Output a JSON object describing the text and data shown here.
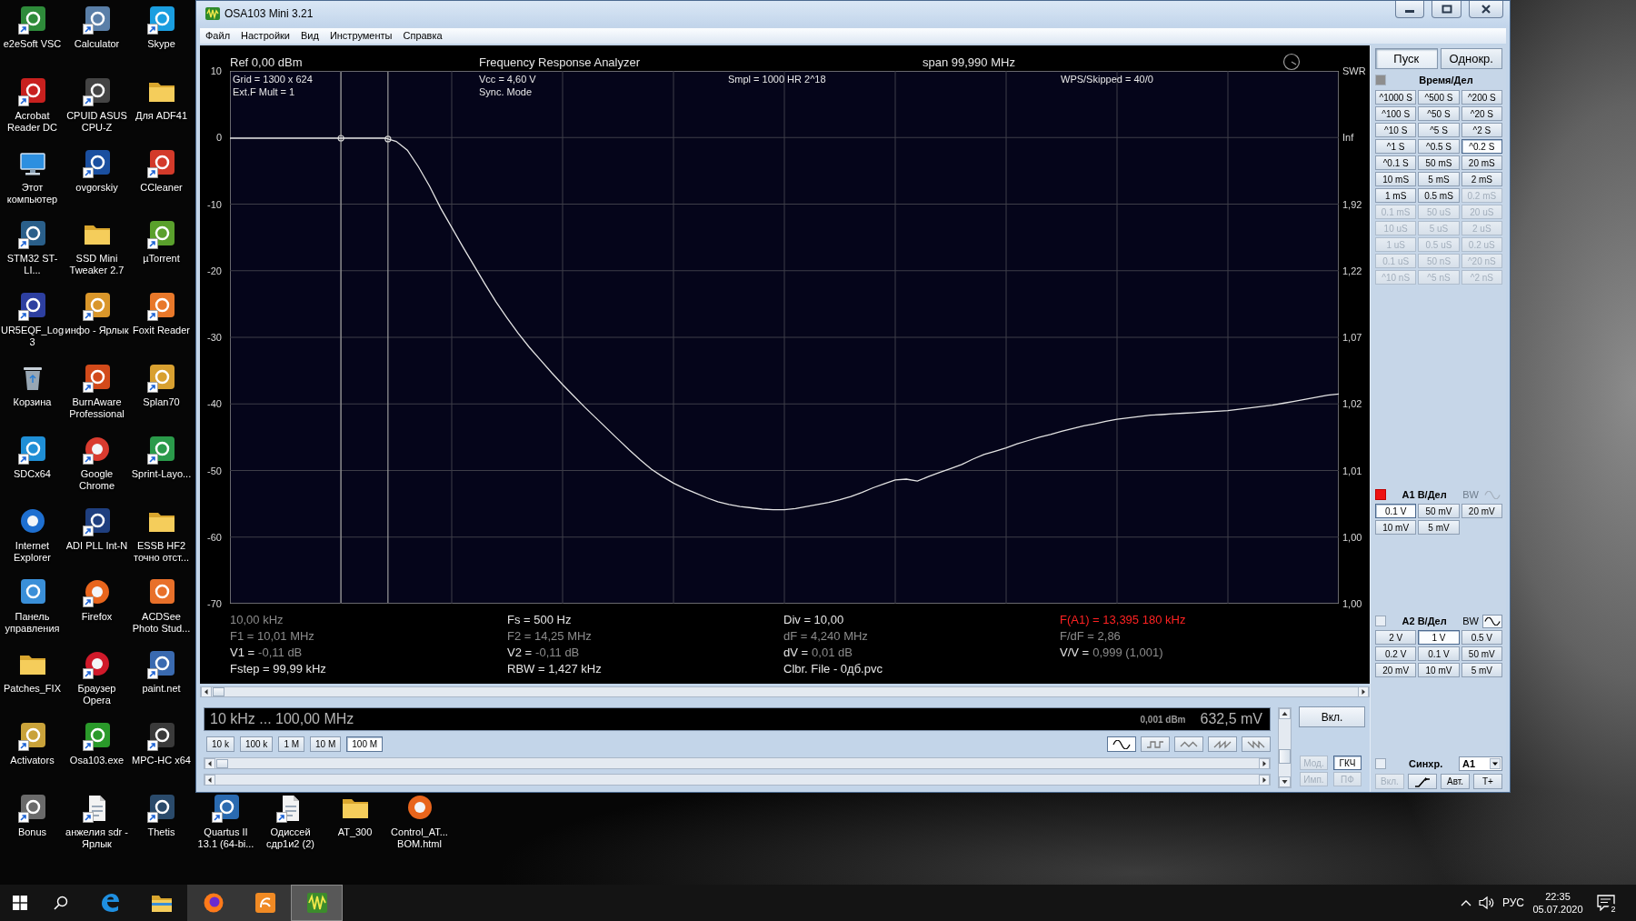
{
  "desktop": {
    "icons": [
      {
        "label": "e2eSoft VSC",
        "kind": "tile",
        "shortcut": true
      },
      {
        "label": "Acrobat Reader DC",
        "kind": "tile",
        "shortcut": true
      },
      {
        "label": "Этот компьютер",
        "kind": "monitor",
        "shortcut": false
      },
      {
        "label": "STM32 ST-LI...",
        "kind": "tile",
        "shortcut": true
      },
      {
        "label": "UR5EQF_Log 3",
        "kind": "tile",
        "shortcut": true
      },
      {
        "label": "Корзина",
        "kind": "trash",
        "shortcut": false
      },
      {
        "label": "SDCx64",
        "kind": "tile",
        "shortcut": true
      },
      {
        "label": "Internet Explorer",
        "kind": "ring",
        "shortcut": false
      },
      {
        "label": "Панель управления",
        "kind": "tile",
        "shortcut": false
      },
      {
        "label": "Patches_FIX",
        "kind": "folder",
        "shortcut": false
      },
      {
        "label": "Activators",
        "kind": "tile",
        "shortcut": true
      },
      {
        "label": "Bonus",
        "kind": "tile",
        "shortcut": true
      },
      {
        "label": "Calculator",
        "kind": "tile",
        "shortcut": true
      },
      {
        "label": "CPUID ASUS CPU-Z",
        "kind": "tile",
        "shortcut": true
      },
      {
        "label": "ovgorskiy",
        "kind": "tile",
        "shortcut": true
      },
      {
        "label": "SSD Mini Tweaker 2.7",
        "kind": "folder",
        "shortcut": false
      },
      {
        "label": "инфо - Ярлык",
        "kind": "tile",
        "shortcut": true
      },
      {
        "label": "BurnAware Professional",
        "kind": "tile",
        "shortcut": true
      },
      {
        "label": "Google Chrome",
        "kind": "ring",
        "shortcut": true
      },
      {
        "label": "ADI PLL Int-N",
        "kind": "tile",
        "shortcut": true
      },
      {
        "label": "Firefox",
        "kind": "ring",
        "shortcut": true
      },
      {
        "label": "Браузер Opera",
        "kind": "ring",
        "shortcut": true
      },
      {
        "label": "Osa103.exe",
        "kind": "tile",
        "shortcut": true
      },
      {
        "label": "анжелия sdr - Ярлык",
        "kind": "document",
        "shortcut": true
      },
      {
        "label": "Skype",
        "kind": "tile",
        "shortcut": true
      },
      {
        "label": "Для ADF41",
        "kind": "folder",
        "shortcut": false
      },
      {
        "label": "CCleaner",
        "kind": "tile",
        "shortcut": true
      },
      {
        "label": "µTorrent",
        "kind": "tile",
        "shortcut": true
      },
      {
        "label": "Foxit Reader",
        "kind": "tile",
        "shortcut": true
      },
      {
        "label": "Splan70",
        "kind": "tile",
        "shortcut": true
      },
      {
        "label": "Sprint-Layo...",
        "kind": "tile",
        "shortcut": true
      },
      {
        "label": "ESSB HF2 точно отст...",
        "kind": "folder",
        "shortcut": false
      },
      {
        "label": "ACDSee Photo Stud...",
        "kind": "tile",
        "shortcut": false
      },
      {
        "label": "paint.net",
        "kind": "tile",
        "shortcut": true
      },
      {
        "label": "MPC-HC x64",
        "kind": "tile",
        "shortcut": true
      },
      {
        "label": "Thetis",
        "kind": "tile",
        "shortcut": true
      },
      {
        "label": "Quartus II 13.1 (64-bi...",
        "kind": "tile",
        "shortcut": true
      },
      {
        "label": "Одиссей сдр1и2 (2)",
        "kind": "document",
        "shortcut": true
      },
      {
        "label": "AT_300",
        "kind": "folder",
        "shortcut": false
      },
      {
        "label": "Control_AT... BOM.html",
        "kind": "ring",
        "shortcut": false
      }
    ]
  },
  "window": {
    "title": "OSA103 Mini 3.21",
    "menu": [
      "Файл",
      "Настройки",
      "Вид",
      "Инструменты",
      "Справка"
    ]
  },
  "plot": {
    "header": {
      "reference": "Ref 0,00 dBm",
      "title": "Frequency Response Analyzer",
      "span": "span 99,990 MHz"
    },
    "info": [
      [
        "Grid = 1300 x 624",
        "Ext.F Mult = 1"
      ],
      [
        "Vcc = 4,60 V",
        "Sync. Mode"
      ],
      [
        "Smpl = 1000 HR 2^18"
      ],
      [
        "WPS/Skipped = 40/0"
      ]
    ],
    "swr_axis": {
      "title": "SWR",
      "labels": [
        "Inf",
        "1,92",
        "1,22",
        "1,07",
        "1,02",
        "1,01",
        "1,00",
        "1,00"
      ]
    },
    "chart_data": {
      "type": "line",
      "categories": [
        null,
        null,
        null,
        null,
        null,
        null,
        null,
        null,
        null,
        null,
        null,
        null,
        null,
        null,
        null,
        null,
        null,
        null,
        null,
        null,
        null,
        null,
        null,
        null,
        null,
        null,
        null,
        null,
        null,
        null,
        null,
        null,
        null,
        null,
        null,
        null,
        null,
        null,
        null,
        null,
        null,
        null,
        null,
        null,
        null,
        null,
        null,
        null,
        null,
        null,
        null,
        null,
        null,
        null,
        null,
        null,
        null,
        null,
        null,
        null,
        null,
        null,
        null,
        null,
        null,
        null,
        null,
        null,
        null,
        null,
        null,
        null,
        null,
        null,
        null,
        null,
        null,
        null,
        null,
        null,
        null,
        null,
        null,
        null,
        null,
        null,
        null,
        null,
        null,
        null,
        null,
        null,
        null,
        null,
        null,
        null,
        null,
        null,
        null,
        null,
        null
      ],
      "series": [
        {
          "color": "#e4e4e4",
          "values": [
            -0.1,
            -0.1,
            -0.1,
            -0.1,
            -0.1,
            -0.1,
            -0.1,
            -0.1,
            -0.1,
            -0.1,
            -0.1,
            -0.1,
            -0.1,
            -0.1,
            -0.1,
            -0.6,
            -1.9,
            -4.4,
            -7.3,
            -10.6,
            -13.5,
            -16.4,
            -19.2,
            -22.0,
            -24.7,
            -27.1,
            -29.4,
            -31.5,
            -33.4,
            -35.3,
            -37.1,
            -38.8,
            -40.5,
            -42.1,
            -43.7,
            -45.3,
            -46.9,
            -48.4,
            -49.8,
            -50.9,
            -51.9,
            -52.7,
            -53.4,
            -54.1,
            -54.7,
            -55.1,
            -55.4,
            -55.6,
            -55.8,
            -55.9,
            -55.9,
            -55.7,
            -55.4,
            -55.1,
            -54.8,
            -54.4,
            -53.9,
            -53.3,
            -52.6,
            -52.0,
            -51.4,
            -51.3,
            -51.6,
            -50.9,
            -50.3,
            -49.7,
            -49.1,
            -48.3,
            -47.6,
            -47.1,
            -46.6,
            -46.0,
            -45.5,
            -45.0,
            -44.6,
            -44.1,
            -43.7,
            -43.3,
            -43.0,
            -42.6,
            -42.3,
            -42.1,
            -41.9,
            -41.7,
            -41.6,
            -41.5,
            -41.4,
            -41.3,
            -41.2,
            -41.1,
            -41.0,
            -40.8,
            -40.6,
            -40.4,
            -40.2,
            -39.9,
            -39.6,
            -39.3,
            -39.0,
            -38.7,
            -38.5
          ]
        }
      ],
      "ylim": [
        -70,
        10
      ],
      "yticks": [
        10,
        0,
        -10,
        -20,
        -30,
        -40,
        -50,
        -60,
        -70
      ],
      "grid": true
    },
    "readouts": [
      [
        {
          "text": "10,00 kHz",
          "kind": "dim"
        },
        {
          "text": "Fs = 500 Hz",
          "kind": "bright"
        },
        {
          "text": "Div = 10,00",
          "kind": "bright"
        },
        {
          "text": "F(A1) = 13,395 180 kHz",
          "kind": "alert"
        }
      ],
      [
        {
          "text": "F1 = 10,01 MHz",
          "kind": "dim"
        },
        {
          "text": "F2 = 14,25 MHz",
          "kind": "dim"
        },
        {
          "text": "dF = 4,240 MHz",
          "kind": "dim"
        },
        {
          "text": "F/dF = 2,86",
          "kind": "dim"
        }
      ],
      [
        {
          "label": "V1 =",
          "value": "-0,11 dB",
          "kind": "split"
        },
        {
          "label": "V2 =",
          "value": "-0,11 dB",
          "kind": "split"
        },
        {
          "label": "dV =",
          "value": "0,01 dB",
          "kind": "split"
        },
        {
          "label": "V/V =",
          "value": "0,999 (1,001)",
          "kind": "split"
        }
      ],
      [
        {
          "text": "Fstep = 99,99 kHz",
          "kind": "bright"
        },
        {
          "text": "RBW = 1,427 kHz",
          "kind": "bright"
        },
        {
          "text": "Clbr. File - 0дб.pvc",
          "kind": "bright"
        }
      ]
    ]
  },
  "generator": {
    "range": "10 kHz ... 100,00 MHz",
    "power": "0,001 dBm",
    "voltage": "632,5 mV",
    "spans": [
      {
        "label": "10 k",
        "selected": false
      },
      {
        "label": "100 k",
        "selected": false
      },
      {
        "label": "1 M",
        "selected": false
      },
      {
        "label": "10 M",
        "selected": false
      },
      {
        "label": "100 M",
        "selected": true
      }
    ],
    "waveforms": [
      {
        "kind": "sine",
        "selected": true
      },
      {
        "kind": "square",
        "selected": false
      },
      {
        "kind": "triangle",
        "selected": false
      },
      {
        "kind": "sawtooth",
        "selected": false
      },
      {
        "kind": "ramp",
        "selected": false
      }
    ],
    "output_button": "Вкл.",
    "modes": [
      {
        "label": "Мод.",
        "selected": false,
        "disabled": true
      },
      {
        "label": "ГКЧ",
        "selected": true,
        "disabled": false
      },
      {
        "label": "Имп.",
        "selected": false,
        "disabled": true
      },
      {
        "label": "ПФ",
        "selected": false,
        "disabled": true
      }
    ]
  },
  "side_panel": {
    "run_buttons": [
      {
        "label": "Пуск",
        "selected": true
      },
      {
        "label": "Однокр.",
        "selected": false
      }
    ],
    "time": {
      "title": "Время/Дел",
      "buttons": [
        {
          "label": "^1000 S",
          "selected": false,
          "disabled": false
        },
        {
          "label": "^500 S",
          "selected": false,
          "disabled": false
        },
        {
          "label": "^200 S",
          "selected": false,
          "disabled": false
        },
        {
          "label": "^100 S",
          "selected": false,
          "disabled": false
        },
        {
          "label": "^50 S",
          "selected": false,
          "disabled": false
        },
        {
          "label": "^20 S",
          "selected": false,
          "disabled": false
        },
        {
          "label": "^10 S",
          "selected": false,
          "disabled": false
        },
        {
          "label": "^5 S",
          "selected": false,
          "disabled": false
        },
        {
          "label": "^2 S",
          "selected": false,
          "disabled": false
        },
        {
          "label": "^1 S",
          "selected": false,
          "disabled": false
        },
        {
          "label": "^0.5 S",
          "selected": false,
          "disabled": false
        },
        {
          "label": "^0.2 S",
          "selected": true,
          "disabled": false
        },
        {
          "label": "^0.1 S",
          "selected": false,
          "disabled": false
        },
        {
          "label": "50 mS",
          "selected": false,
          "disabled": false
        },
        {
          "label": "20 mS",
          "selected": false,
          "disabled": false
        },
        {
          "label": "10 mS",
          "selected": false,
          "disabled": false
        },
        {
          "label": "5 mS",
          "selected": false,
          "disabled": false
        },
        {
          "label": "2 mS",
          "selected": false,
          "disabled": false
        },
        {
          "label": "1 mS",
          "selected": false,
          "disabled": false
        },
        {
          "label": "0.5 mS",
          "selected": false,
          "disabled": false
        },
        {
          "label": "0.2 mS",
          "selected": false,
          "disabled": true
        },
        {
          "label": "0.1 mS",
          "selected": false,
          "disabled": true
        },
        {
          "label": "50 uS",
          "selected": false,
          "disabled": true
        },
        {
          "label": "20 uS",
          "selected": false,
          "disabled": true
        },
        {
          "label": "10 uS",
          "selected": false,
          "disabled": true
        },
        {
          "label": "5 uS",
          "selected": false,
          "disabled": true
        },
        {
          "label": "2 uS",
          "selected": false,
          "disabled": true
        },
        {
          "label": "1 uS",
          "selected": false,
          "disabled": true
        },
        {
          "label": "0.5 uS",
          "selected": false,
          "disabled": true
        },
        {
          "label": "0.2 uS",
          "selected": false,
          "disabled": true
        },
        {
          "label": "0.1 uS",
          "selected": false,
          "disabled": true
        },
        {
          "label": "50 nS",
          "selected": false,
          "disabled": true
        },
        {
          "label": "^20 nS",
          "selected": false,
          "disabled": true
        },
        {
          "label": "^10 nS",
          "selected": false,
          "disabled": true
        },
        {
          "label": "^5 nS",
          "selected": false,
          "disabled": true
        },
        {
          "label": "^2 nS",
          "selected": false,
          "disabled": true
        }
      ]
    },
    "channels": [
      {
        "title": "A1 В/Дел",
        "on": true,
        "bw": {
          "label": "BW",
          "disabled": true
        },
        "buttons": [
          {
            "label": "0.1 V",
            "selected": true
          },
          {
            "label": "50 mV",
            "selected": false
          },
          {
            "label": "20 mV",
            "selected": false
          },
          {
            "label": "10 mV",
            "selected": false
          },
          {
            "label": "5 mV",
            "selected": false
          }
        ]
      },
      {
        "title": "A2 В/Дел",
        "on": false,
        "bw": {
          "label": "BW",
          "disabled": false
        },
        "buttons": [
          {
            "label": "2 V",
            "selected": false
          },
          {
            "label": "1 V",
            "selected": true
          },
          {
            "label": "0.5 V",
            "selected": false
          },
          {
            "label": "0.2 V",
            "selected": false
          },
          {
            "label": "0.1 V",
            "selected": false
          },
          {
            "label": "50 mV",
            "selected": false
          },
          {
            "label": "20 mV",
            "selected": false
          },
          {
            "label": "10 mV",
            "selected": false
          },
          {
            "label": "5 mV",
            "selected": false
          }
        ]
      }
    ],
    "sync": {
      "checked": false,
      "label": "Синхр.",
      "source": "A1"
    },
    "actions": [
      {
        "kind": "text",
        "label": "Вкл.",
        "disabled": true
      },
      {
        "kind": "slope",
        "disabled": false
      },
      {
        "kind": "text",
        "label": "Авт.",
        "disabled": false
      },
      {
        "kind": "text",
        "label": "T+",
        "disabled": false
      }
    ]
  },
  "taskbar": {
    "apps": [
      {
        "kind": "browser",
        "running": false,
        "selected": false
      },
      {
        "kind": "folder",
        "running": false,
        "selected": false
      },
      {
        "kind": "fox",
        "running": true,
        "selected": false
      },
      {
        "kind": "pdf",
        "running": true,
        "selected": false
      },
      {
        "kind": "wave",
        "running": true,
        "selected": true
      }
    ],
    "language": "РУС",
    "time": "22:35",
    "date": "05.07.2020",
    "notifications": "2"
  }
}
